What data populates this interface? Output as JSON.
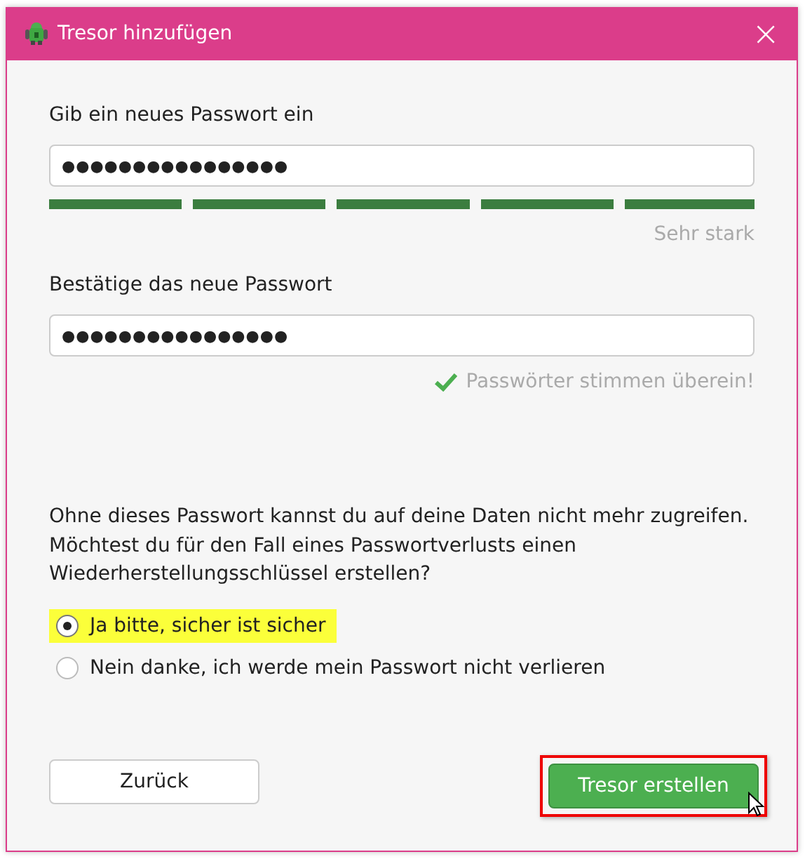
{
  "window": {
    "title": "Tresor hinzufügen",
    "close": "×"
  },
  "password": {
    "label": "Gib ein neues Passwort ein",
    "value": "●●●●●●●●●●●●●●●●",
    "strength": {
      "level": 1,
      "reading": "Sehr stark"
    }
  },
  "confirm": {
    "label": "Bestätige das neue Passwort",
    "value": "●●●●●●●●●●●●●●●●",
    "match": {
      "ok": true,
      "message": "Passwörter stimmen überein!"
    }
  },
  "question": "Ohne dieses Passwort kannst du auf deine Daten nicht mehr zugreifen. Möchtest du für den Fall eines Passwortverlusts einen Wiederherstellungsschlüssel erstellen?",
  "options": [
    {
      "label": "Ja bitte, sicher ist sicher",
      "selected": true,
      "highlighted": true
    },
    {
      "label": "Nein danke, ich werde mein Passwort nicht verlieren",
      "selected": false,
      "highlighted": false
    }
  ],
  "buttons": [
    {
      "label": "Zurück",
      "kind": "secondary",
      "annotated": false
    },
    {
      "label": "Tresor erstellen",
      "kind": "primary",
      "annotated": true
    }
  ]
}
